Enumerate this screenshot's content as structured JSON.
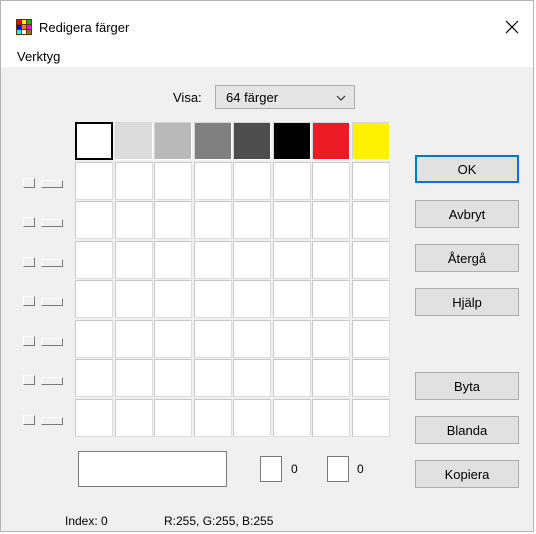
{
  "window": {
    "title": "Redigera färger",
    "close_glyph": "✕"
  },
  "menu": {
    "items": [
      "Verktyg"
    ]
  },
  "view": {
    "label": "Visa:",
    "selected": "64 färger"
  },
  "palette": {
    "colors": [
      "#ffffff",
      "#dcdcdc",
      "#b9b9b9",
      "#808080",
      "#4d4d4d",
      "#000000",
      "#ed1c24",
      "#fff200"
    ],
    "selected_index": 0,
    "rows": 8,
    "cols": 8
  },
  "buttons": {
    "ok": "OK",
    "cancel": "Avbryt",
    "revert": "Återgå",
    "help": "Hjälp",
    "swap": "Byta",
    "mix": "Blanda",
    "copy": "Kopiera"
  },
  "fields": {
    "value1": "0",
    "value2": "0"
  },
  "status": {
    "index": "Index: 0",
    "rgb": "R:255, G:255, B:255"
  },
  "icons": {
    "app": "palette-app-icon",
    "close": "close-icon",
    "dropdown": "chevron-down-icon"
  }
}
